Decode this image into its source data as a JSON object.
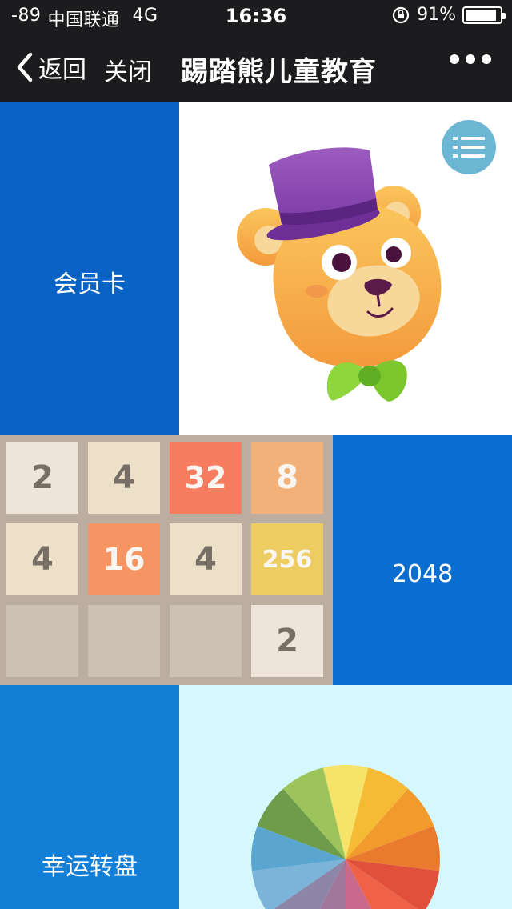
{
  "status_bar": {
    "signal": "-89",
    "carrier": "中国联通",
    "network": "4G",
    "time": "16:36",
    "battery_text": "91%",
    "battery_level": 0.91
  },
  "nav": {
    "back_label": "返回",
    "close_label": "关闭",
    "title": "踢踏熊儿童教育"
  },
  "tiles": {
    "member_card": "会员卡",
    "game_2048": "2048",
    "lucky_wheel": "幸运转盘"
  },
  "game_board": {
    "cells": [
      "2",
      "4",
      "32",
      "8",
      "4",
      "16",
      "4",
      "256",
      "",
      "",
      "",
      "2"
    ]
  },
  "colors": {
    "member_bg": "#0863c4",
    "game_bg": "#0a6ed0",
    "wheel_label_bg": "#137ed6",
    "wheel_bg": "#d4f8fc",
    "menu_button": "#6ab6d3"
  },
  "icons": [
    "chevron-left-icon",
    "more-dots-icon",
    "menu-list-icon",
    "rotation-lock-icon",
    "battery-icon"
  ]
}
